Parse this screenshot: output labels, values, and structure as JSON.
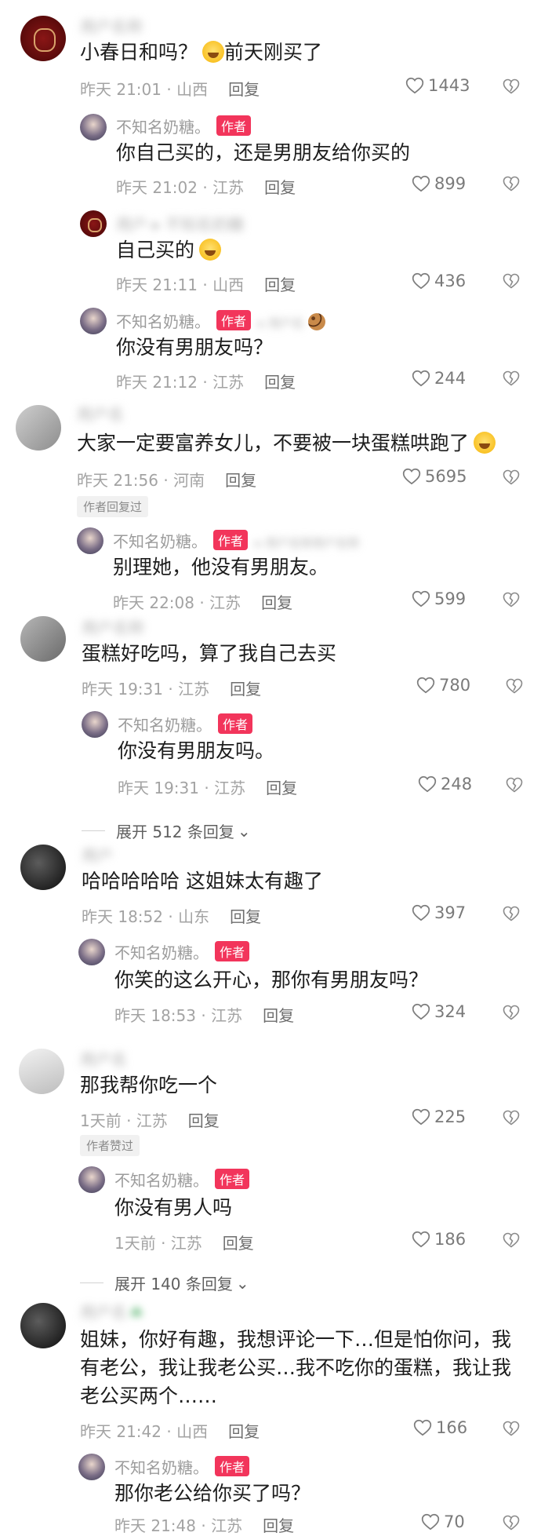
{
  "author_name": "不知名奶糖。",
  "author_badge": "作者",
  "reply_label": "回复",
  "comments": [
    {
      "text": "小春日和吗？",
      "text_after_emoji": "前天刚买了",
      "time": "昨天 21:01 · 山西",
      "likes": "1443",
      "replies": [
        {
          "text": "你自己买的，还是男朋友给你买的",
          "time": "昨天 21:02 · 江苏",
          "likes": "899"
        },
        {
          "text": "自己买的",
          "time": "昨天 21:11 · 山西",
          "likes": "436"
        },
        {
          "text": "你没有男朋友吗？",
          "time": "昨天 21:12 · 江苏",
          "likes": "244"
        }
      ]
    },
    {
      "text": "大家一定要富养女儿，不要被一块蛋糕哄跑了",
      "time": "昨天 21:56 · 河南",
      "likes": "5695",
      "tag": "作者回复过",
      "replies": [
        {
          "text": "别理她，他没有男朋友。",
          "time": "昨天 22:08 · 江苏",
          "likes": "599"
        }
      ]
    },
    {
      "text": "蛋糕好吃吗，算了我自己去买",
      "time": "昨天 19:31 · 江苏",
      "likes": "780",
      "replies": [
        {
          "text": "你没有男朋友吗。",
          "time": "昨天 19:31 · 江苏",
          "likes": "248"
        }
      ],
      "expand": "展开 512 条回复"
    },
    {
      "text": "哈哈哈哈哈 这姐妹太有趣了",
      "time": "昨天 18:52 · 山东",
      "likes": "397",
      "replies": [
        {
          "text": "你笑的这么开心，那你有男朋友吗？",
          "time": "昨天 18:53 · 江苏",
          "likes": "324"
        }
      ]
    },
    {
      "text": "那我帮你吃一个",
      "time": "1天前 · 江苏",
      "likes": "225",
      "tag": "作者赞过",
      "replies": [
        {
          "text": "你没有男人吗",
          "time": "1天前 · 江苏",
          "likes": "186"
        }
      ],
      "expand": "展开 140 条回复"
    },
    {
      "text_line1": "姐妹，你好有趣，我想评论一下…但是怕你问，我",
      "text_line2": "有老公，我让我老公买…我不吃你的蛋糕，我让我",
      "text_line3": "老公买两个……",
      "time": "昨天 21:42 · 山西",
      "likes": "166",
      "replies": [
        {
          "text": "那你老公给你买了吗？",
          "time": "昨天 21:48 · 江苏",
          "likes": "70"
        }
      ]
    }
  ]
}
